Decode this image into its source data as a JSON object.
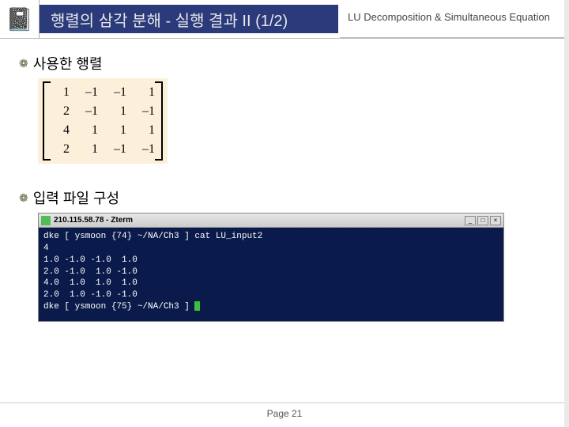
{
  "header": {
    "title": "행렬의 삼각 분해 - 실행 결과 II (1/2)",
    "subtitle": "LU Decomposition & Simultaneous Equation"
  },
  "sections": {
    "matrix": {
      "title": "사용한 행렬"
    },
    "input": {
      "title": "입력 파일 구성"
    }
  },
  "matrix": {
    "rows": [
      [
        "1",
        "–1",
        "–1",
        "1"
      ],
      [
        "2",
        "–1",
        "1",
        "–1"
      ],
      [
        "4",
        "1",
        "1",
        "1"
      ],
      [
        "2",
        "1",
        "–1",
        "–1"
      ]
    ]
  },
  "terminal": {
    "window_title": "210.115.58.78 - Zterm",
    "btn_min": "_",
    "btn_max": "□",
    "btn_close": "×",
    "lines": [
      "dke [ ysmoon {74} ~/NA/Ch3 ] cat LU_input2",
      "4",
      "1.0 -1.0 -1.0  1.0",
      "2.0 -1.0  1.0 -1.0",
      "4.0  1.0  1.0  1.0",
      "2.0  1.0 -1.0 -1.0",
      "dke [ ysmoon {75} ~/NA/Ch3 ] "
    ]
  },
  "footer": {
    "page": "Page 21"
  }
}
